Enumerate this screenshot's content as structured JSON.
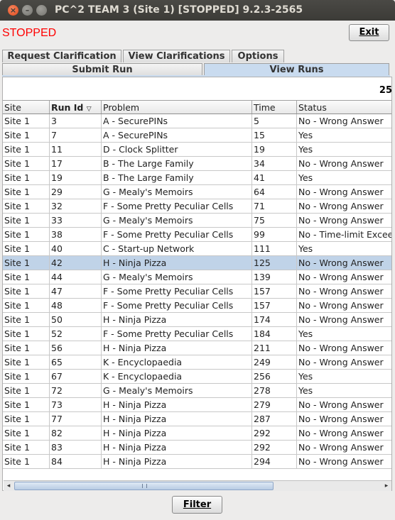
{
  "window": {
    "title": "PC^2 TEAM 3 (Site 1) [STOPPED] 9.2.3-2565",
    "close_glyph": "×",
    "minimize_glyph": "–"
  },
  "status": {
    "text": "STOPPED",
    "color": "#ff0000"
  },
  "exit_button": {
    "label": "Exit"
  },
  "tabs_top": [
    {
      "label": "Request Clarification"
    },
    {
      "label": "View Clarifications"
    },
    {
      "label": "Options"
    }
  ],
  "tabs_bottom": [
    {
      "label": "Submit Run",
      "selected": false
    },
    {
      "label": "View Runs",
      "selected": true
    }
  ],
  "run_count": "25",
  "table": {
    "columns": [
      "Site",
      "Run Id",
      "Problem",
      "Time",
      "Status"
    ],
    "sort_indicator": "▽",
    "selected_row": 10,
    "rows": [
      [
        "Site 1",
        "3",
        "A - SecurePINs",
        "5",
        "No - Wrong Answer"
      ],
      [
        "Site 1",
        "7",
        "A - SecurePINs",
        "15",
        "Yes"
      ],
      [
        "Site 1",
        "11",
        "D - Clock Splitter",
        "19",
        "Yes"
      ],
      [
        "Site 1",
        "17",
        "B - The Large Family",
        "34",
        "No - Wrong Answer"
      ],
      [
        "Site 1",
        "19",
        "B - The Large Family",
        "41",
        "Yes"
      ],
      [
        "Site 1",
        "29",
        "G - Mealy's Memoirs",
        "64",
        "No - Wrong Answer"
      ],
      [
        "Site 1",
        "32",
        "F - Some Pretty Peculiar Cells",
        "71",
        "No - Wrong Answer"
      ],
      [
        "Site 1",
        "33",
        "G - Mealy's Memoirs",
        "75",
        "No - Wrong Answer"
      ],
      [
        "Site 1",
        "38",
        "F - Some Pretty Peculiar Cells",
        "99",
        "No - Time-limit Exceed"
      ],
      [
        "Site 1",
        "40",
        "C - Start-up Network",
        "111",
        "Yes"
      ],
      [
        "Site 1",
        "42",
        "H - Ninja Pizza",
        "125",
        "No - Wrong Answer"
      ],
      [
        "Site 1",
        "44",
        "G - Mealy's Memoirs",
        "139",
        "No - Wrong Answer"
      ],
      [
        "Site 1",
        "47",
        "F - Some Pretty Peculiar Cells",
        "157",
        "No - Wrong Answer"
      ],
      [
        "Site 1",
        "48",
        "F - Some Pretty Peculiar Cells",
        "157",
        "No - Wrong Answer"
      ],
      [
        "Site 1",
        "50",
        "H - Ninja Pizza",
        "174",
        "No - Wrong Answer"
      ],
      [
        "Site 1",
        "52",
        "F - Some Pretty Peculiar Cells",
        "184",
        "Yes"
      ],
      [
        "Site 1",
        "56",
        "H - Ninja Pizza",
        "211",
        "No - Wrong Answer"
      ],
      [
        "Site 1",
        "65",
        "K - Encyclopaedia",
        "249",
        "No - Wrong Answer"
      ],
      [
        "Site 1",
        "67",
        "K - Encyclopaedia",
        "256",
        "Yes"
      ],
      [
        "Site 1",
        "72",
        "G - Mealy's Memoirs",
        "278",
        "Yes"
      ],
      [
        "Site 1",
        "73",
        "H - Ninja Pizza",
        "279",
        "No - Wrong Answer"
      ],
      [
        "Site 1",
        "77",
        "H - Ninja Pizza",
        "287",
        "No - Wrong Answer"
      ],
      [
        "Site 1",
        "82",
        "H - Ninja Pizza",
        "292",
        "No - Wrong Answer"
      ],
      [
        "Site 1",
        "83",
        "H - Ninja Pizza",
        "292",
        "No - Wrong Answer"
      ],
      [
        "Site 1",
        "84",
        "H - Ninja Pizza",
        "294",
        "No - Wrong Answer"
      ]
    ]
  },
  "scrollbar": {
    "left_glyph": "◂",
    "right_glyph": "▸"
  },
  "filter_button": {
    "label": "Filter"
  }
}
